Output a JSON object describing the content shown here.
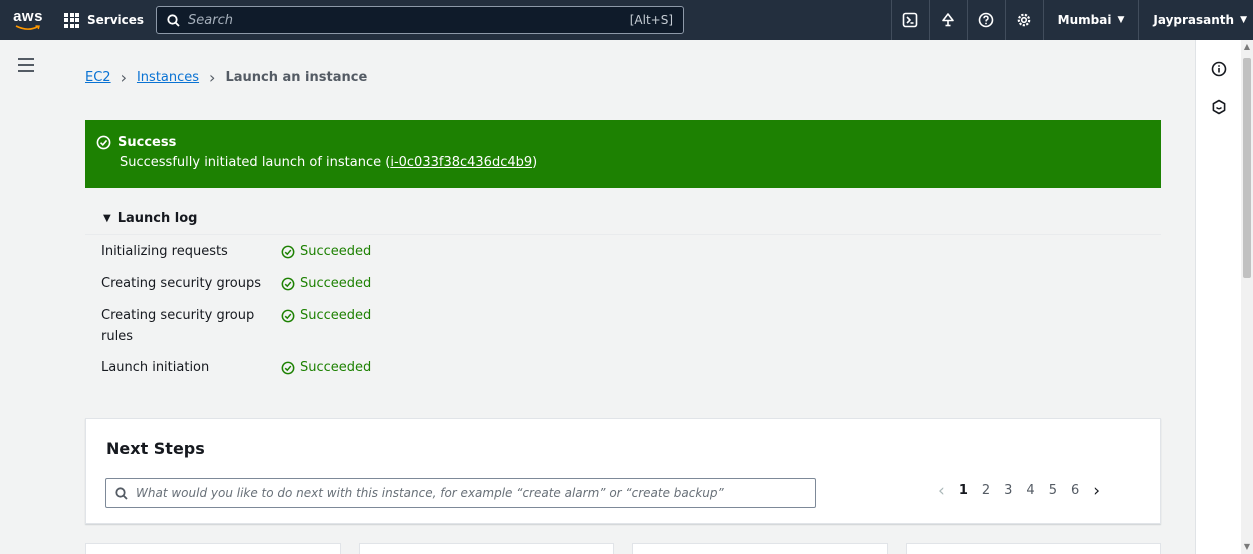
{
  "topnav": {
    "logo_text": "aws",
    "services_label": "Services",
    "search_placeholder": "Search",
    "search_shortcut": "[Alt+S]",
    "region": "Mumbai",
    "user": "Jayprasanth",
    "icons": [
      "cloudshell-icon",
      "bell-icon",
      "help-icon",
      "settings-icon"
    ]
  },
  "breadcrumb": {
    "items": [
      "EC2",
      "Instances"
    ],
    "current": "Launch an instance"
  },
  "flash": {
    "title": "Success",
    "message_prefix": "Successfully initiated launch of instance (",
    "instance_id": "i-0c033f38c436dc4b9",
    "message_suffix": ")",
    "color": "#1d8102"
  },
  "launch_log": {
    "title": "Launch log",
    "rows": [
      {
        "name": "Initializing requests",
        "status": "Succeeded"
      },
      {
        "name": "Creating security groups",
        "status": "Succeeded"
      },
      {
        "name": "Creating security group rules",
        "status": "Succeeded"
      },
      {
        "name": "Launch initiation",
        "status": "Succeeded"
      }
    ]
  },
  "next_steps": {
    "title": "Next Steps",
    "search_placeholder": "What would you like to do next with this instance, for example “create alarm” or “create backup”",
    "pages": [
      "1",
      "2",
      "3",
      "4",
      "5",
      "6"
    ],
    "current_page": "1"
  },
  "colors": {
    "nav_bg": "#232f3e",
    "link": "#0972d3",
    "success": "#1d8102"
  }
}
